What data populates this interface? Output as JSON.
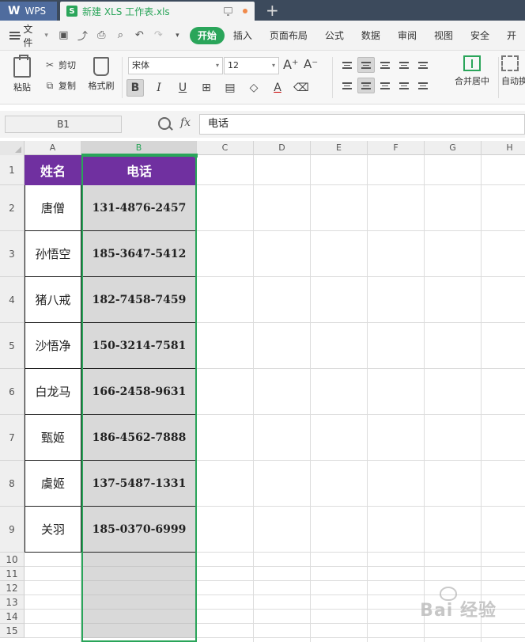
{
  "titlebar": {
    "app_tab": "WPS",
    "doc_tab_title": "新建 XLS 工作表.xls",
    "doc_icon_letter": "S",
    "new_tab_symbol": "+"
  },
  "menubar": {
    "file_label": "文件",
    "tabs": [
      "开始",
      "插入",
      "页面布局",
      "公式",
      "数据",
      "审阅",
      "视图",
      "安全",
      "开"
    ]
  },
  "ribbon": {
    "paste_label": "粘贴",
    "cut_label": "剪切",
    "copy_label": "复制",
    "format_brush_label": "格式刷",
    "font_name": "宋体",
    "font_size": "12",
    "merge_label": "合并居中",
    "wrap_label": "自动换"
  },
  "formula_bar": {
    "name_box": "B1",
    "fx_label": "fx",
    "content": "电话"
  },
  "sheet": {
    "columns": [
      "A",
      "B",
      "C",
      "D",
      "E",
      "F",
      "G",
      "H"
    ],
    "selected_column": "B",
    "rows": [
      "1",
      "2",
      "3",
      "4",
      "5",
      "6",
      "7",
      "8",
      "9",
      "10",
      "11",
      "12",
      "13",
      "14",
      "15"
    ],
    "header": {
      "name": "姓名",
      "phone": "电话"
    },
    "records": [
      {
        "name": "唐僧",
        "phone": "131-4876-2457"
      },
      {
        "name": "孙悟空",
        "phone": "185-3647-5412"
      },
      {
        "name": "猪八戒",
        "phone": "182-7458-7459"
      },
      {
        "name": "沙悟净",
        "phone": "150-3214-7581"
      },
      {
        "name": "白龙马",
        "phone": "166-2458-9631"
      },
      {
        "name": "甄姬",
        "phone": "186-4562-7888"
      },
      {
        "name": "虞姬",
        "phone": "137-5487-1331"
      },
      {
        "name": "关羽",
        "phone": "185-0370-6999"
      }
    ]
  },
  "colors": {
    "header_fill": "#7030a0",
    "phone_fill": "#d9d9d9",
    "accent_green": "#2aa55a"
  },
  "watermark": "Bai 经验"
}
